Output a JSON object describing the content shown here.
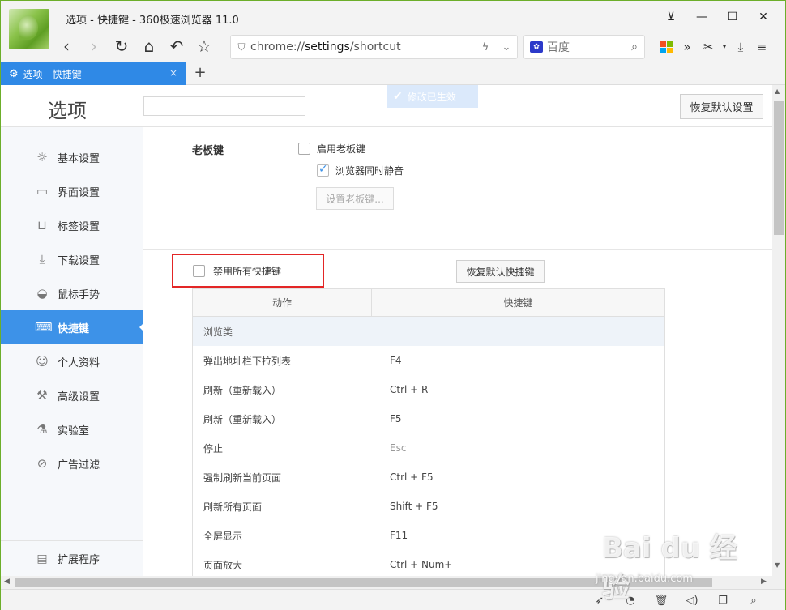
{
  "window": {
    "title": "选项 - 快捷键 - 360极速浏览器 11.0",
    "controls": [
      "⊻",
      "—",
      "☐",
      "✕"
    ]
  },
  "address_bar": {
    "scheme": "chrome://",
    "host": "settings",
    "path": "/shortcut"
  },
  "search": {
    "engine": "百度",
    "placeholder": "百度"
  },
  "tab": {
    "label": "选项 - 快捷键",
    "close": "×",
    "new": "+"
  },
  "header": {
    "title": "选项",
    "toast": "修改已生效",
    "reset_all": "恢复默认设置"
  },
  "sidebar": {
    "items": [
      {
        "label": "基本设置",
        "icon": "gear-icon"
      },
      {
        "label": "界面设置",
        "icon": "window-icon"
      },
      {
        "label": "标签设置",
        "icon": "tab-icon"
      },
      {
        "label": "下载设置",
        "icon": "download-icon"
      },
      {
        "label": "鼠标手势",
        "icon": "mouse-icon"
      },
      {
        "label": "快捷键",
        "icon": "keyboard-icon"
      },
      {
        "label": "个人资料",
        "icon": "user-icon"
      },
      {
        "label": "高级设置",
        "icon": "wrench-icon"
      },
      {
        "label": "实验室",
        "icon": "flask-icon"
      },
      {
        "label": "广告过滤",
        "icon": "block-icon"
      }
    ],
    "active": "快捷键",
    "bottom": "扩展程序"
  },
  "boss_key": {
    "label": "老板键",
    "enable_label": "启用老板键",
    "enable_checked": false,
    "mute_label": "浏览器同时静音",
    "mute_checked": true,
    "set_button": "设置老板键..."
  },
  "shortcuts": {
    "disable_all_label": "禁用所有快捷键",
    "disable_all_checked": false,
    "reset_button": "恢复默认快捷键",
    "columns": [
      "动作",
      "快捷键"
    ],
    "group": "浏览类",
    "rows": [
      {
        "action": "弹出地址栏下拉列表",
        "key": "F4"
      },
      {
        "action": "刷新（重新载入）",
        "key": "Ctrl + R"
      },
      {
        "action": "刷新（重新载入）",
        "key": "F5"
      },
      {
        "action": "停止",
        "key": "Esc"
      },
      {
        "action": "强制刷新当前页面",
        "key": "Ctrl + F5"
      },
      {
        "action": "刷新所有页面",
        "key": "Shift + F5"
      },
      {
        "action": "全屏显示",
        "key": "F11"
      },
      {
        "action": "页面放大",
        "key": "Ctrl + Num+"
      }
    ]
  },
  "watermark": {
    "main": "Bai du 经验",
    "sub": "jingyan.baidu.com"
  },
  "colors": {
    "accent": "#3d92e8",
    "highlight_box": "#e32626",
    "frame": "#6cae2a"
  }
}
